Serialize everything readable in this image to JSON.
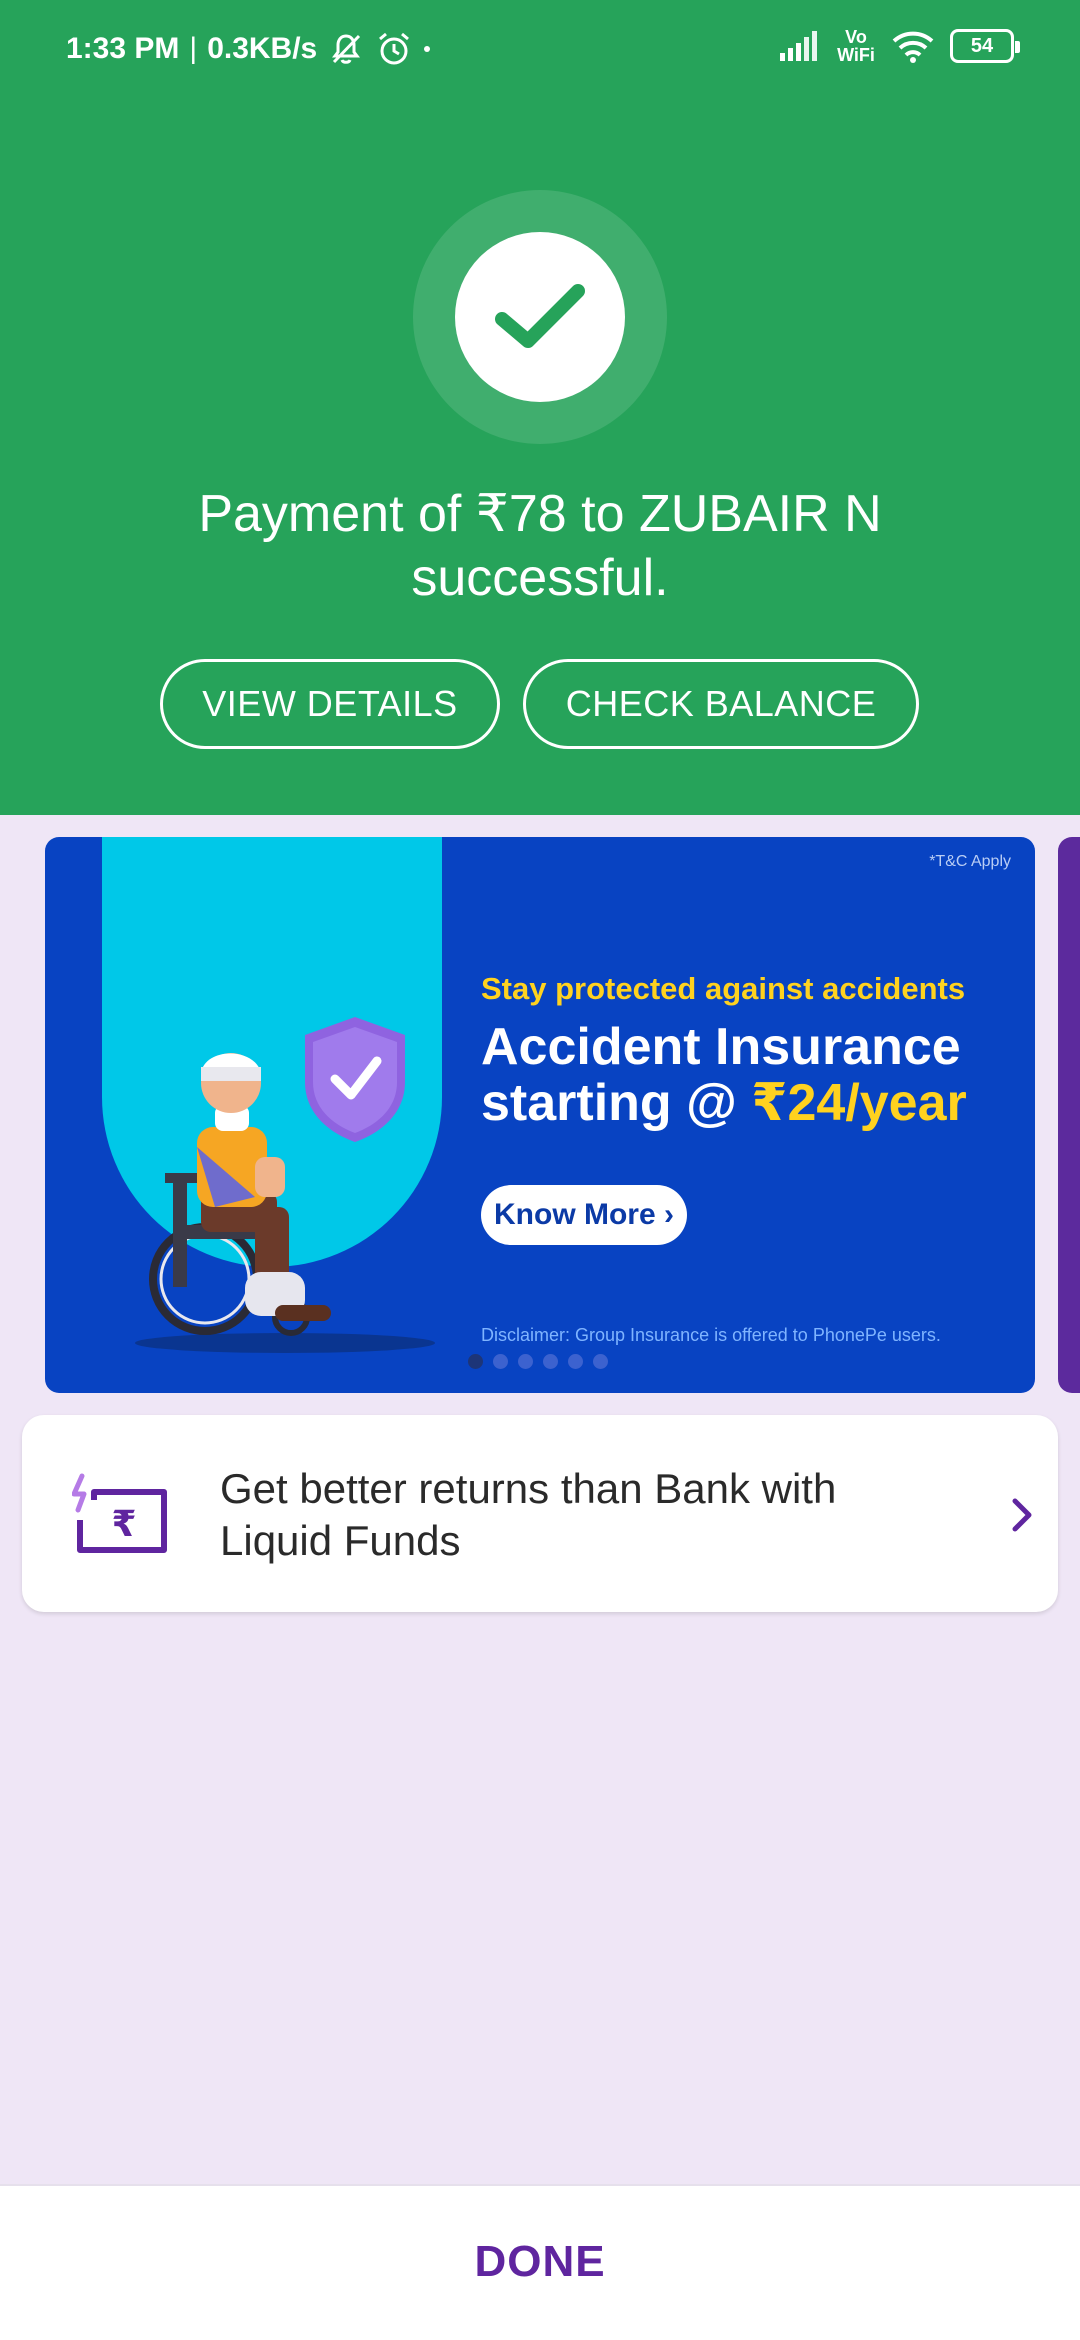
{
  "status_bar": {
    "time": "1:33 PM",
    "separator": "|",
    "net_speed": "0.3KB/s",
    "vowifi_top": "Vo",
    "vowifi_bottom": "WiFi",
    "battery": "54",
    "icons": [
      "mute-icon",
      "alarm-icon",
      "signal-icon",
      "wifi-icon",
      "battery-icon"
    ]
  },
  "payment": {
    "message": "Payment of ₹78 to ZUBAIR N successful.",
    "view_details_label": "VIEW DETAILS",
    "check_balance_label": "CHECK BALANCE"
  },
  "banner": {
    "tnc": "*T&C Apply",
    "kicker": "Stay protected against accidents",
    "title_line1": "Accident Insurance",
    "title_line2_prefix": "starting @ ",
    "title_line2_highlight": "₹24/year",
    "cta_label": "Know More ›",
    "disclaimer": "Disclaimer: Group Insurance is offered to PhonePe users.",
    "carousel_count": 6,
    "carousel_active_index": 0
  },
  "fund_card": {
    "text": "Get better returns than Bank with Liquid Funds",
    "icon": "rupee-card-icon"
  },
  "footer": {
    "done_label": "DONE"
  },
  "colors": {
    "success_green": "#26a35a",
    "page_background": "#efe6f6",
    "banner_blue": "#0843c2",
    "highlight_yellow": "#ffd21f",
    "brand_purple": "#5f259f"
  }
}
